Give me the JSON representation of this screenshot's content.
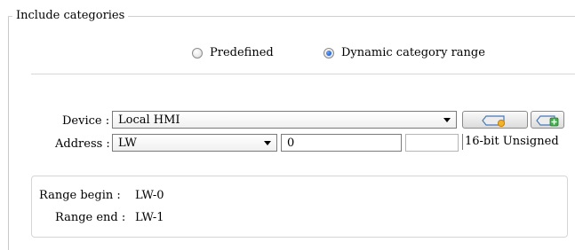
{
  "include_categories": {
    "title": "Include categories",
    "radio_predefined": "Predefined",
    "radio_dynamic": "Dynamic category range",
    "selected": "Dynamic category range"
  },
  "device": {
    "label": "Device :",
    "value": "Local HMI"
  },
  "address": {
    "label": "Address :",
    "type_value": "LW",
    "offset_value": "0",
    "format": "16-bit Unsigned"
  },
  "range": {
    "begin_label": "Range begin :",
    "begin_value": "LW-0",
    "end_label": "Range end :",
    "end_value": "LW-1"
  },
  "icons": {
    "edit": "edit-device-icon",
    "add": "add-device-icon"
  }
}
